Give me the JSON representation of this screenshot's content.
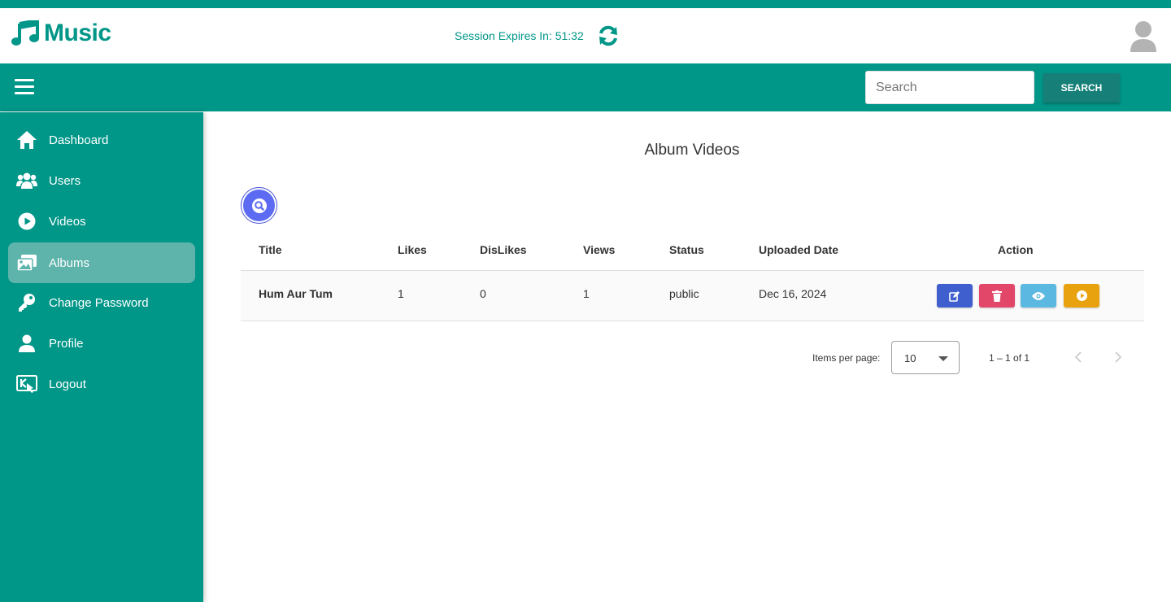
{
  "app": {
    "name": "Music"
  },
  "header": {
    "session_text": "Session Expires In: 51:32"
  },
  "toolbar": {
    "search_placeholder": "Search",
    "search_button": "SEARCH"
  },
  "sidebar": {
    "items": [
      {
        "label": "Dashboard",
        "icon": "home-icon",
        "active": false
      },
      {
        "label": "Users",
        "icon": "users-icon",
        "active": false
      },
      {
        "label": "Videos",
        "icon": "play-circle-icon",
        "active": false
      },
      {
        "label": "Albums",
        "icon": "images-icon",
        "active": true
      },
      {
        "label": "Change Password",
        "icon": "key-icon",
        "active": false
      },
      {
        "label": "Profile",
        "icon": "user-icon",
        "active": false
      },
      {
        "label": "Logout",
        "icon": "logout-icon",
        "active": false
      }
    ]
  },
  "main": {
    "title": "Album Videos",
    "table": {
      "columns": [
        "Title",
        "Likes",
        "DisLikes",
        "Views",
        "Status",
        "Uploaded Date",
        "Action"
      ],
      "rows": [
        {
          "title": "Hum Aur Tum",
          "likes": "1",
          "dislikes": "0",
          "views": "1",
          "status": "public",
          "uploaded": "Dec 16, 2024"
        }
      ],
      "actions": [
        {
          "icon": "edit-icon",
          "color": "#3f5fcf"
        },
        {
          "icon": "trash-icon",
          "color": "#e2476a"
        },
        {
          "icon": "eye-icon",
          "color": "#5bb8e0"
        },
        {
          "icon": "play-icon",
          "color": "#e8a20f"
        }
      ]
    },
    "paginator": {
      "label": "Items per page:",
      "page_size": "10",
      "range": "1 – 1 of 1"
    }
  },
  "colors": {
    "primary": "#009688",
    "active_nav": "#5eb3ab",
    "fab": "#5c6bf2"
  }
}
